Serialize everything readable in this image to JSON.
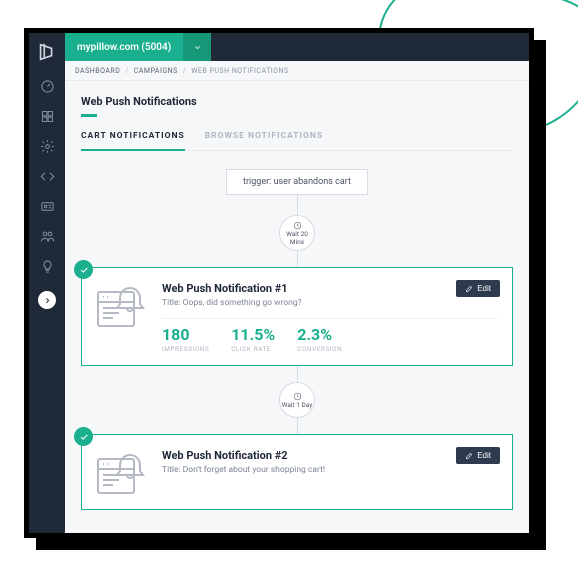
{
  "header": {
    "domain_label": "mypillow.com (5004)"
  },
  "breadcrumbs": {
    "item0": "DASHBOARD",
    "item1": "CAMPAIGNS",
    "item2": "WEB PUSH NOTIFICATIONS"
  },
  "page": {
    "title": "Web Push Notifications"
  },
  "tabs": {
    "active": "CART NOTIFICATIONS",
    "inactive": "BROWSE NOTIFICATIONS"
  },
  "trigger": {
    "label": "trigger: user abandons cart"
  },
  "waits": {
    "w1_line1": "Wait 20",
    "w1_line2": "Mins",
    "w2_line1": "Wait 1 Day"
  },
  "card1": {
    "title": "Web Push Notification #1",
    "subtitle": "Title: Oops, did something go wrong?",
    "edit": "Edit",
    "stats": {
      "impressions_val": "180",
      "impressions_lab": "IMPRESSIONS",
      "click_val": "11.5%",
      "click_lab": "CLICK RATE",
      "conv_val": "2.3%",
      "conv_lab": "CONVERSION"
    }
  },
  "card2": {
    "title": "Web Push Notification #2",
    "subtitle": "Title: Don't forget about your shopping cart!",
    "edit": "Edit"
  },
  "colors": {
    "accent": "#1aaf8e",
    "dark": "#202938"
  }
}
